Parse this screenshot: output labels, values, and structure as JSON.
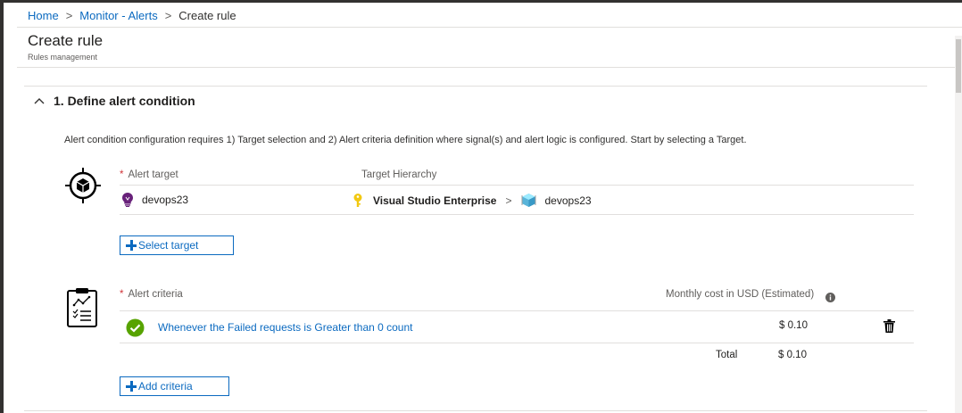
{
  "breadcrumb": {
    "home": "Home",
    "monitor": "Monitor - Alerts",
    "current": "Create rule",
    "separator": ">"
  },
  "page": {
    "title": "Create rule",
    "subtitle": "Rules management"
  },
  "section": {
    "title": "1. Define alert condition",
    "description": "Alert condition configuration requires 1) Target selection and 2) Alert criteria definition where signal(s) and alert logic is configured. Start by selecting a Target."
  },
  "target": {
    "required_mark": "*",
    "label": "Alert target",
    "hierarchy_label": "Target Hierarchy",
    "resource_name": "devops23",
    "subscription": "Visual Studio Enterprise",
    "hierarchy_sep": ">",
    "hierarchy_resource": "devops23",
    "select_button": "Select target"
  },
  "criteria": {
    "required_mark": "*",
    "label": "Alert criteria",
    "cost_label": "Monthly cost in USD (Estimated)",
    "rows": [
      {
        "text": "Whenever the Failed requests is Greater than 0 count",
        "cost": "$ 0.10"
      }
    ],
    "total_label": "Total",
    "total_value": "$ 0.10",
    "add_button": "Add criteria"
  },
  "colors": {
    "link": "#0b6ac0",
    "required": "#d13438",
    "success": "#57a300",
    "key": "#f2c811"
  },
  "icons": {
    "collapse": "chevron-up-icon",
    "target": "target-icon",
    "criteria": "clipboard-icon",
    "app_insights": "lightbulb-icon",
    "subscription": "key-icon",
    "resource": "cube-icon",
    "success": "check-circle-icon",
    "info": "info-icon",
    "delete": "trash-icon"
  }
}
